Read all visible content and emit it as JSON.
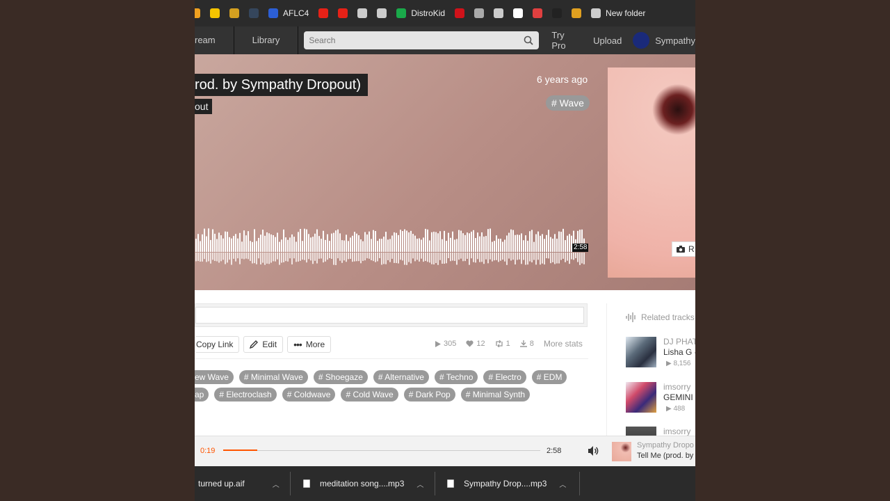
{
  "bookmarks": [
    {
      "label": "",
      "icon": "bookmark-orange-icon",
      "color": "#f0a020"
    },
    {
      "label": "",
      "icon": "play-yellow-icon",
      "color": "#f5c400"
    },
    {
      "label": "",
      "icon": "bookmark-yellow-icon",
      "color": "#d4a020"
    },
    {
      "label": "",
      "icon": "tumblr-icon",
      "color": "#35465c"
    },
    {
      "label": "AFLC4",
      "icon": "aflc4-icon",
      "color": "#2c5fd6"
    },
    {
      "label": "",
      "icon": "youtube-icon",
      "color": "#e62117"
    },
    {
      "label": "",
      "icon": "record-red-icon",
      "color": "#e62117"
    },
    {
      "label": "",
      "icon": "globe-icon",
      "color": "#cccccc"
    },
    {
      "label": "",
      "icon": "window-icon",
      "color": "#cccccc"
    },
    {
      "label": "DistroKid",
      "icon": "distrokid-icon",
      "color": "#1aa94a"
    },
    {
      "label": "",
      "icon": "red-app-icon",
      "color": "#d0121a"
    },
    {
      "label": "",
      "icon": "apple-icon",
      "color": "#aaaaaa"
    },
    {
      "label": "",
      "icon": "globe-icon",
      "color": "#cccccc"
    },
    {
      "label": "",
      "icon": "edd-icon",
      "color": "#ffffff"
    },
    {
      "label": "",
      "icon": "red-circle-app-icon",
      "color": "#e04040"
    },
    {
      "label": "",
      "icon": "thumbs-up-icon",
      "color": "#222222"
    },
    {
      "label": "",
      "icon": "ss-icon",
      "color": "#e0a020"
    },
    {
      "label": "New folder",
      "icon": "folder-icon",
      "color": "#cccccc"
    }
  ],
  "nav": {
    "stream": "ream",
    "library": "Library",
    "search_placeholder": "Search",
    "try_pro": "Try Pro",
    "upload": "Upload",
    "user": "Sympathy"
  },
  "hero": {
    "title": "rod. by Sympathy Dropout)",
    "artist": "out",
    "posted": "6 years ago",
    "genre": "# Wave",
    "duration": "2:58",
    "replace_label": "R"
  },
  "actions": {
    "copy_link": "Copy Link",
    "edit": "Edit",
    "more": "More"
  },
  "stats": {
    "plays": "305",
    "likes": "12",
    "reposts": "1",
    "downloads": "8",
    "more_stats": "More stats"
  },
  "tags_row1": [
    "ew Wave",
    "# Minimal Wave",
    "# Shoegaze",
    "# Alternative",
    "# Techno",
    "# Electro",
    "# EDM"
  ],
  "tags_row2": [
    "ap",
    "# Electroclash",
    "# Coldwave",
    "# Cold Wave",
    "# Dark Pop",
    "# Minimal Synth"
  ],
  "related": {
    "title": "Related tracks",
    "items": [
      {
        "artist": "DJ PHAT",
        "title": "Lisha G -",
        "plays": "8,156"
      },
      {
        "artist": "imsorry",
        "title": "GEMINI",
        "plays": "488"
      },
      {
        "artist": "imsorry",
        "title": "",
        "plays": ""
      }
    ]
  },
  "player": {
    "current": "0:19",
    "total": "2:58",
    "progress": 0.107,
    "artist": "Sympathy Dropo",
    "title": "Tell Me (prod. by"
  },
  "downloads": [
    {
      "label": "turned up.aif"
    },
    {
      "label": "meditation song....mp3"
    },
    {
      "label": "Sympathy Drop....mp3"
    }
  ],
  "colors": {
    "accent": "#ff5500",
    "hero_bg": "#b88e86",
    "tag_bg": "#999999"
  }
}
